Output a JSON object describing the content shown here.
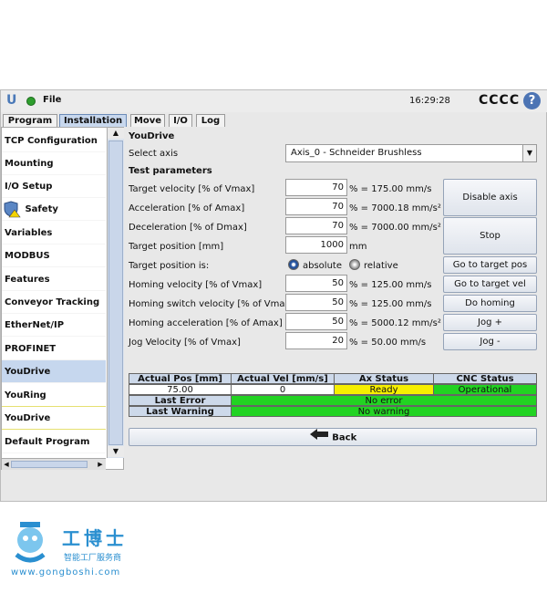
{
  "titlebar": {
    "file_label": "File",
    "clock": "16:29:28",
    "robot_name": "CCCC",
    "help_glyph": "?"
  },
  "tabs": [
    {
      "label": "Program"
    },
    {
      "label": "Installation"
    },
    {
      "label": "Move"
    },
    {
      "label": "I/O"
    },
    {
      "label": "Log"
    }
  ],
  "sidebar": {
    "items": [
      {
        "label": "TCP Configuration"
      },
      {
        "label": "Mounting"
      },
      {
        "label": "I/O Setup"
      },
      {
        "label": "Safety"
      },
      {
        "label": "Variables"
      },
      {
        "label": "MODBUS"
      },
      {
        "label": "Features"
      },
      {
        "label": "Conveyor Tracking"
      },
      {
        "label": "EtherNet/IP"
      },
      {
        "label": "PROFINET"
      },
      {
        "label": "YouDrive"
      },
      {
        "label": "YouRing"
      },
      {
        "label": "YouDrive"
      },
      {
        "label": "Default Program"
      }
    ]
  },
  "main": {
    "title": "YouDrive",
    "select_axis_label": "Select axis",
    "select_axis_value": "Axis_0 - Schneider Brushless",
    "test_params_label": "Test parameters",
    "params": [
      {
        "label": "Target velocity [% of Vmax]",
        "value": "70",
        "unit": "% = 175.00 mm/s"
      },
      {
        "label": "Acceleration [% of Amax]",
        "value": "70",
        "unit": "% = 7000.18 mm/s²"
      },
      {
        "label": "Deceleration [% of Dmax]",
        "value": "70",
        "unit": "% = 7000.00 mm/s²"
      },
      {
        "label": "Target position [mm]",
        "value": "1000",
        "unit": "mm"
      }
    ],
    "target_pos_is_label": "Target position is:",
    "radio_absolute": "absolute",
    "radio_relative": "relative",
    "homing_params": [
      {
        "label": "Homing velocity [% of Vmax]",
        "value": "50",
        "unit": "% = 125.00 mm/s"
      },
      {
        "label": "Homing switch velocity [% of Vmax]",
        "value": "50",
        "unit": "% = 125.00 mm/s"
      },
      {
        "label": "Homing acceleration [% of Amax]",
        "value": "50",
        "unit": "% = 5000.12 mm/s²"
      },
      {
        "label": "Jog Velocity [% of Vmax]",
        "value": "20",
        "unit": "% = 50.00 mm/s"
      }
    ],
    "buttons": {
      "disable_axis": "Disable axis",
      "stop": "Stop",
      "go_target_pos": "Go to target pos",
      "go_target_vel": "Go to target vel",
      "do_homing": "Do homing",
      "jog_plus": "Jog +",
      "jog_minus": "Jog -",
      "back": "Back"
    },
    "status": {
      "headers": [
        "Actual Pos [mm]",
        "Actual Vel [mm/s]",
        "Ax Status",
        "CNC Status"
      ],
      "values": [
        "75.00",
        "0",
        "Ready",
        "Operational"
      ],
      "last_error_label": "Last Error",
      "last_error_value": "No error",
      "last_warning_label": "Last Warning",
      "last_warning_value": "No warning"
    }
  },
  "watermark": {
    "brand": "工博士",
    "tagline": "智能工厂服务商",
    "url": "www.gongboshi.com"
  },
  "colors": {
    "ready": "#f6ef00",
    "ok": "#22d322",
    "accent": "#4c74b4"
  }
}
